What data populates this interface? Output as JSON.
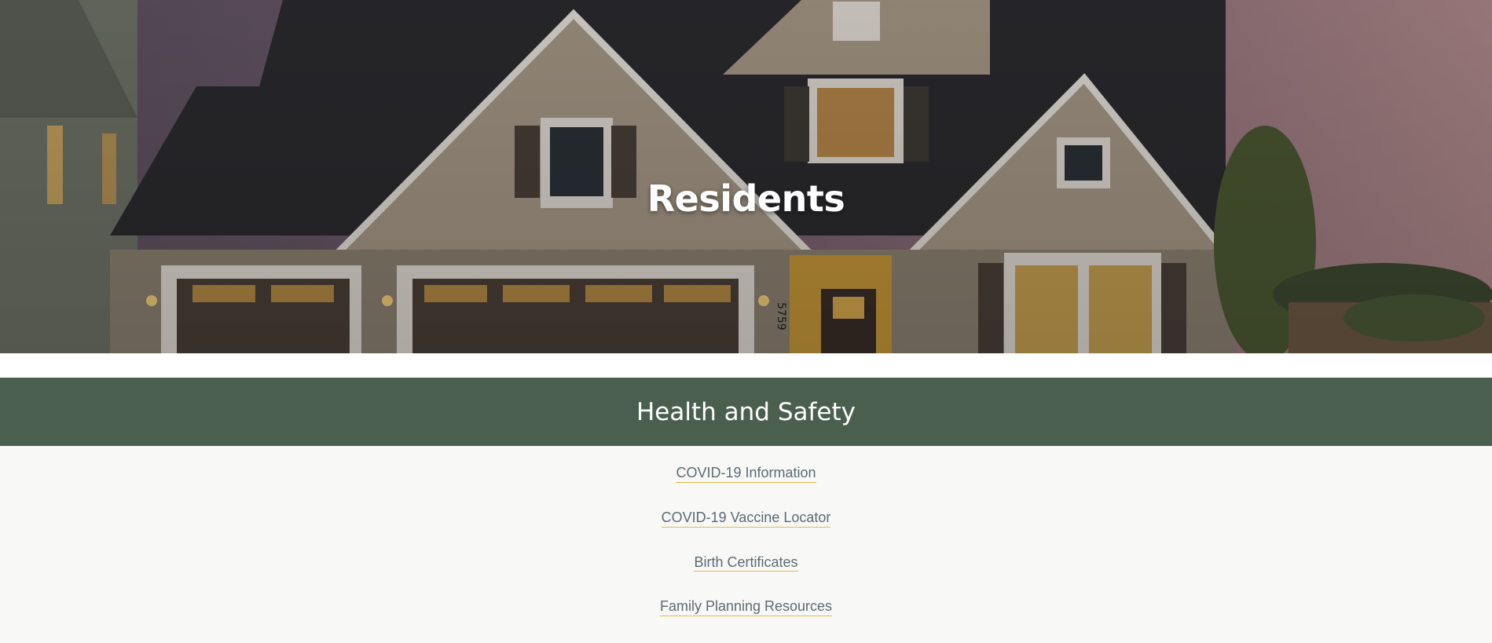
{
  "hero": {
    "title": "Residents",
    "image": "house-exterior-photo"
  },
  "section": {
    "title": "Health and Safety"
  },
  "links": [
    {
      "label": "COVID-19 Information"
    },
    {
      "label": "COVID-19 Vaccine Locator"
    },
    {
      "label": "Birth Certificates"
    },
    {
      "label": "Family Planning Resources"
    }
  ],
  "colors": {
    "band": "#4b5f4f",
    "link_underline": "#e6b94a",
    "link_text": "#5c6b72"
  },
  "house_number": "5759"
}
